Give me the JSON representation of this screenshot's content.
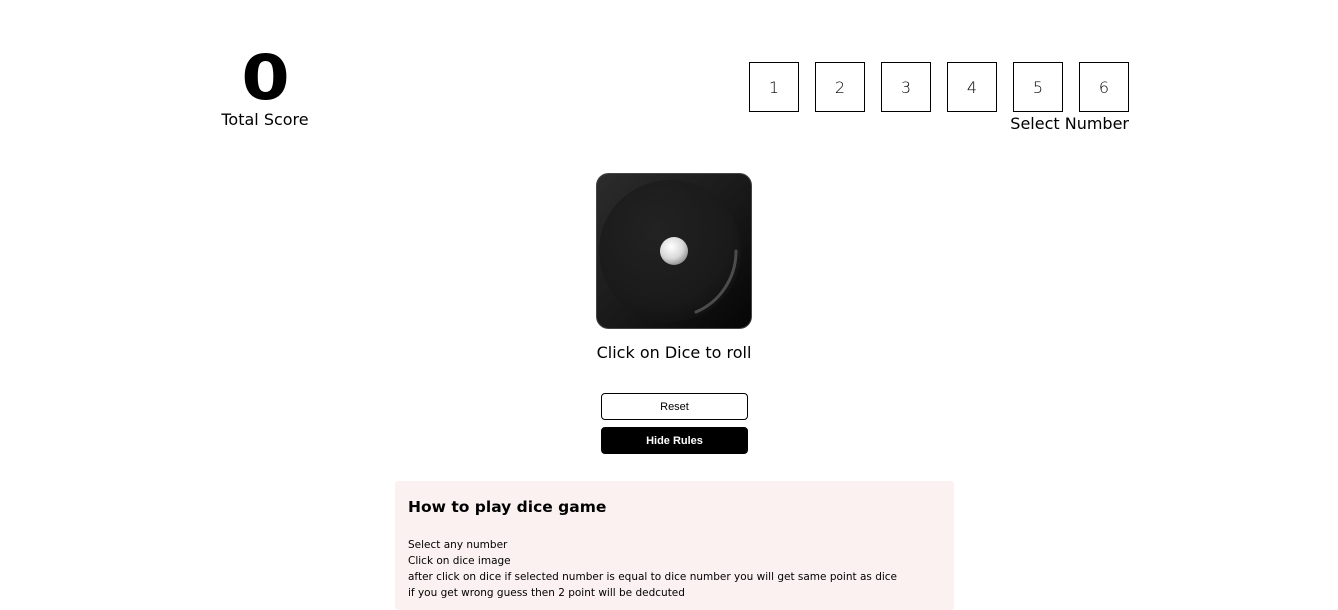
{
  "score": {
    "value": "0",
    "label": "Total Score"
  },
  "number_selector": {
    "numbers": [
      "1",
      "2",
      "3",
      "4",
      "5",
      "6"
    ],
    "label": "Select Number"
  },
  "dice": {
    "face": 1,
    "caption": "Click on Dice to roll"
  },
  "buttons": {
    "reset": "Reset",
    "toggle_rules": "Hide Rules"
  },
  "rules": {
    "title": "How to play dice game",
    "lines": [
      "Select any number",
      "Click on dice image",
      "after click on dice if selected number is equal to dice number you will get same point as dice",
      "if you get wrong guess then 2 point will be dedcuted"
    ]
  },
  "colors": {
    "primary": "#000000",
    "background": "#ffffff",
    "rules_background": "#fbf1f1"
  }
}
